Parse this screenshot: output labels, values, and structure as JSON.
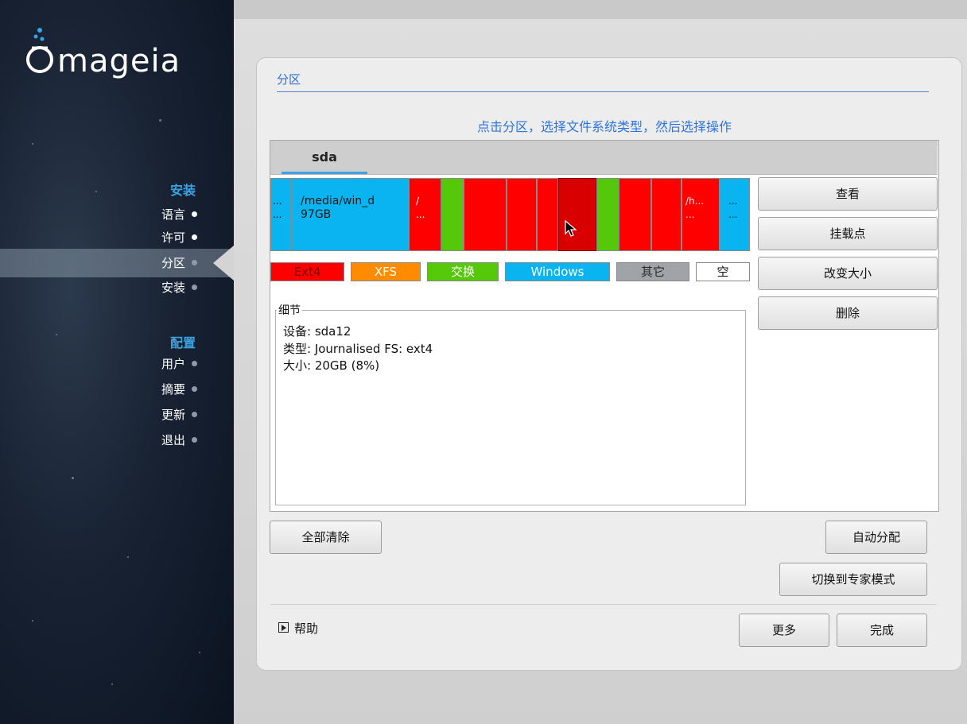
{
  "sidebar": {
    "brand": "mageia",
    "install_heading": "安装",
    "install_items": [
      {
        "label": "语言",
        "state": "done"
      },
      {
        "label": "许可",
        "state": "done"
      },
      {
        "label": "分区",
        "state": "current"
      },
      {
        "label": "安装",
        "state": "pending"
      }
    ],
    "config_heading": "配置",
    "config_items": [
      {
        "label": "用户",
        "state": "pending"
      },
      {
        "label": "摘要",
        "state": "pending"
      },
      {
        "label": "更新",
        "state": "pending"
      },
      {
        "label": "退出",
        "state": "pending"
      }
    ]
  },
  "page": {
    "title": "分区",
    "instructions": "点击分区，选择文件系统类型，然后选择操作"
  },
  "disk_tab": "sda",
  "partitions": [
    {
      "color": "blue",
      "line1": "...",
      "line2": "..."
    },
    {
      "color": "blue",
      "line1": "/media/win_d",
      "line2": "97GB"
    },
    {
      "color": "red",
      "line1": "/",
      "line2": "..."
    },
    {
      "color": "green",
      "line1": "",
      "line2": ""
    },
    {
      "color": "red",
      "line1": "",
      "line2": ""
    },
    {
      "color": "red",
      "line1": "",
      "line2": ""
    },
    {
      "color": "red",
      "line1": "",
      "line2": ""
    },
    {
      "color": "selected",
      "line1": "",
      "line2": ""
    },
    {
      "color": "green",
      "line1": "",
      "line2": ""
    },
    {
      "color": "red",
      "line1": "",
      "line2": ""
    },
    {
      "color": "red",
      "line1": "",
      "line2": ""
    },
    {
      "color": "red",
      "line1": "/h...",
      "line2": "..."
    },
    {
      "color": "blue",
      "line1": "...",
      "line2": "..."
    }
  ],
  "legend": [
    {
      "label": "Ext4",
      "color": "#ff0000"
    },
    {
      "label": "XFS",
      "color": "#ff8c00"
    },
    {
      "label": "交换",
      "color": "#55c80a"
    },
    {
      "label": "Windows",
      "color": "#0ab4f0"
    },
    {
      "label": "其它",
      "color": "#a0a4a8"
    },
    {
      "label": "空",
      "color": "#ffffff"
    }
  ],
  "details": {
    "label": "细节",
    "device": "设备: sda12",
    "type": "类型: Journalised FS: ext4",
    "size": "大小: 20GB (8%)"
  },
  "actions": {
    "view": "查看",
    "mount_point": "挂载点",
    "resize": "改变大小",
    "delete": "删除"
  },
  "buttons": {
    "clear_all": "全部清除",
    "auto_allocate": "自动分配",
    "expert_mode": "切换到专家模式",
    "help": "帮助",
    "more": "更多",
    "done": "完成"
  },
  "colors": {
    "accent": "#3aa3e3",
    "ext4": "#ff0000",
    "swap": "#55c80a",
    "windows": "#0ab4f0",
    "selected": "#d80000"
  }
}
